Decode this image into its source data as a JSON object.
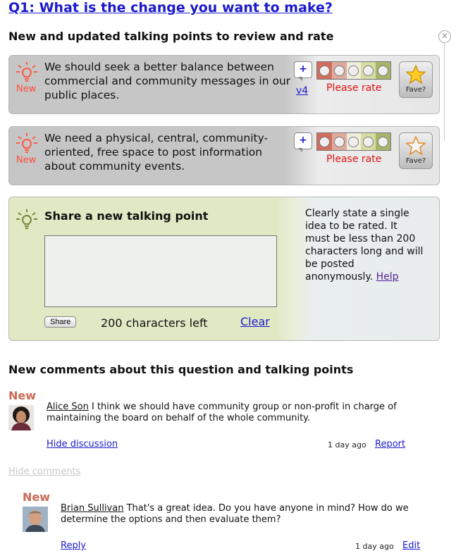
{
  "question": {
    "title": "Q1: What is the change you want to make?"
  },
  "tp_section": {
    "heading": "New and updated talking points to review and rate",
    "close": "✕"
  },
  "talking_points": [
    {
      "new": "New",
      "text": "We should seek a better balance between commercial and community messages in our public places.",
      "plus": "+",
      "version": "v4",
      "rate_prompt": "Please rate",
      "fave": "Fave?"
    },
    {
      "new": "New",
      "text": "We need a physical, central, community-oriented, free space to post information about community events.",
      "plus": "+",
      "version": "",
      "rate_prompt": "Please rate",
      "fave": "Fave?"
    }
  ],
  "rating_colors": [
    "#d26e5e",
    "#e0a99e",
    "#eeeedd",
    "#d6dca2",
    "#a7b56a"
  ],
  "share": {
    "title": "Share a new talking point",
    "button": "Share",
    "chars_left": "200 characters left",
    "clear": "Clear",
    "help_text": "Clearly state a single idea to be rated. It must be less than 200 characters long and will be posted anonymously.",
    "help_link": "Help"
  },
  "comments_section": {
    "heading": "New comments about this question and talking points"
  },
  "comments": [
    {
      "new": "New",
      "author": "Alice Son",
      "text": " I think we should have community group or non-profit in charge of maintaining the board on behalf of the whole community.",
      "action": "Hide discussion",
      "time": "1 day ago",
      "action2": "Report"
    },
    {
      "new": "New",
      "author": "Brian Sullivan",
      "text": " That's a great idea. Do you have anyone in mind? How do we determine the options and then evaluate them?",
      "action": "Reply",
      "time": "1 day ago",
      "action2": "Edit"
    }
  ],
  "hide_comments": "Hide comments"
}
